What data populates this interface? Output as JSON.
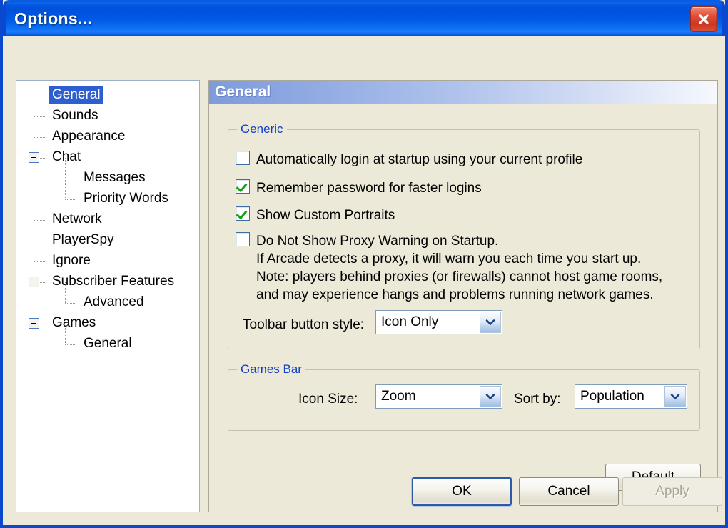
{
  "window": {
    "title": "Options...",
    "close_icon": "close-icon"
  },
  "tree": {
    "items": [
      {
        "label": "General",
        "depth": 1,
        "selected": true,
        "expander": "none"
      },
      {
        "label": "Sounds",
        "depth": 1,
        "selected": false,
        "expander": "none"
      },
      {
        "label": "Appearance",
        "depth": 1,
        "selected": false,
        "expander": "none"
      },
      {
        "label": "Chat",
        "depth": 1,
        "selected": false,
        "expander": "minus"
      },
      {
        "label": "Messages",
        "depth": 2,
        "selected": false,
        "expander": "none"
      },
      {
        "label": "Priority Words",
        "depth": 2,
        "selected": false,
        "expander": "none"
      },
      {
        "label": "Network",
        "depth": 1,
        "selected": false,
        "expander": "none"
      },
      {
        "label": "PlayerSpy",
        "depth": 1,
        "selected": false,
        "expander": "none"
      },
      {
        "label": "Ignore",
        "depth": 1,
        "selected": false,
        "expander": "none"
      },
      {
        "label": "Subscriber Features",
        "depth": 1,
        "selected": false,
        "expander": "minus"
      },
      {
        "label": "Advanced",
        "depth": 2,
        "selected": false,
        "expander": "none"
      },
      {
        "label": "Games",
        "depth": 1,
        "selected": false,
        "expander": "minus"
      },
      {
        "label": "General",
        "depth": 2,
        "selected": false,
        "expander": "none"
      }
    ]
  },
  "panel": {
    "header_title": "General",
    "generic": {
      "legend": "Generic",
      "checkboxes": [
        {
          "label": "Automatically login at startup using your current profile",
          "checked": false
        },
        {
          "label": "Remember password for faster logins",
          "checked": true
        },
        {
          "label": "Show Custom Portraits",
          "checked": true
        },
        {
          "label": "Do Not Show Proxy Warning on Startup.",
          "checked": false
        }
      ],
      "proxy_note_lines": [
        "If Arcade detects a proxy, it will warn you each time you start up.",
        "Note: players behind proxies (or firewalls) cannot host game rooms,",
        "and may experience hangs and problems running network games."
      ],
      "toolbar_style": {
        "label": "Toolbar button style:",
        "value": "Icon Only"
      }
    },
    "games_bar": {
      "legend": "Games Bar",
      "icon_size": {
        "label": "Icon Size:",
        "value": "Zoom"
      },
      "sort_by": {
        "label": "Sort by:",
        "value": "Population"
      }
    },
    "default_button": "Default"
  },
  "footer": {
    "ok": "OK",
    "cancel": "Cancel",
    "apply": "Apply"
  },
  "colors": {
    "title_bar_blue": "#0050DB",
    "dialog_face": "#ECE9D8",
    "selection_blue": "#2D5FD0",
    "legend_blue": "#1040C8",
    "check_green": "#17A016",
    "close_red": "#CE3620"
  }
}
